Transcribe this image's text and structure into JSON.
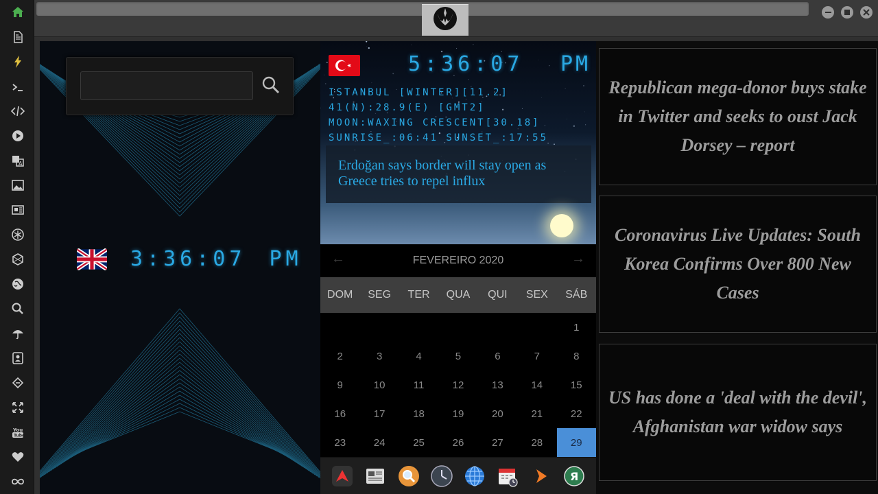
{
  "top": {
    "search": {
      "placeholder": ""
    }
  },
  "uk_clock": {
    "time": "3:36:07",
    "ampm": "PM"
  },
  "weather": {
    "time": "5:36:07",
    "ampm": "PM",
    "lines": [
      "ISTANBUL [WINTER][11.2]",
      "41(N):28.9(E) [GMT2]",
      "MOON:WAXING CRESCENT[30.18]",
      "SUNRISE_:06:41 SUNSET_:17:55"
    ],
    "headline": "Erdoğan says border will stay open as Greece tries to repel influx"
  },
  "calendar": {
    "month": "FEVEREIRO 2020",
    "weekdays": [
      "DOM",
      "SEG",
      "TER",
      "QUA",
      "QUI",
      "SEX",
      "SÁB"
    ],
    "weeks": [
      [
        "",
        "",
        "",
        "",
        "",
        "",
        "1"
      ],
      [
        "2",
        "3",
        "4",
        "5",
        "6",
        "7",
        "8"
      ],
      [
        "9",
        "10",
        "11",
        "12",
        "13",
        "14",
        "15"
      ],
      [
        "16",
        "17",
        "18",
        "19",
        "20",
        "21",
        "22"
      ],
      [
        "23",
        "24",
        "25",
        "26",
        "27",
        "28",
        "29"
      ]
    ],
    "selected": "29"
  },
  "news": [
    "Republican mega-donor buys stake in Twitter and seeks to oust Jack Dorsey – report",
    "Coronavirus Live Updates: South Korea Confirms Over 800 New Cases",
    "US has done a 'deal with the devil', Afghanistan war widow says"
  ],
  "colors": {
    "accent": "#2aa9e4",
    "selected_day": "#4a8fd8",
    "home": "#4caf50"
  }
}
